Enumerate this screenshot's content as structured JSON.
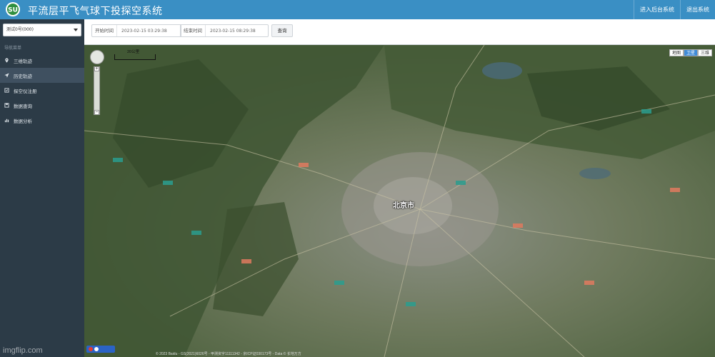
{
  "header": {
    "logo_text": "SU",
    "title": "平流层平飞气球下投探空系统",
    "links": [
      "进入后台系统",
      "退出系统"
    ]
  },
  "sidebar": {
    "device_select": "测试0号(000)",
    "menu_title": "导航菜单",
    "items": [
      {
        "label": "三维轨迹",
        "icon": "location-pin-icon",
        "active": false
      },
      {
        "label": "历史轨迹",
        "icon": "send-arrow-icon",
        "active": true
      },
      {
        "label": "探空仪注册",
        "icon": "register-icon",
        "active": false
      },
      {
        "label": "数据查询",
        "icon": "database-icon",
        "active": false
      },
      {
        "label": "数据分析",
        "icon": "chart-icon",
        "active": false
      }
    ]
  },
  "toolbar": {
    "start_label": "开始时间",
    "start_value": "2023-02-15 03:29:38",
    "end_label": "结束时间",
    "end_value": "2023-02-15 08:29:38",
    "query_label": "查询"
  },
  "map": {
    "scale_label": "20公里",
    "maptype": [
      "地图",
      "卫星",
      "三维"
    ],
    "maptype_active": "卫星",
    "city_label": "北京市",
    "copyright": "© 2023 Baidu - GS(2021)6026号 - 甲测资字11111342 - 京ICP证030173号 - Data © 长地万方"
  },
  "watermark": "imgflip.com",
  "colors": {
    "header": "#3a8fc4",
    "sidebar": "#2c3b47",
    "sidebar_active": "#3f5060",
    "accent": "#3f8bd8"
  }
}
